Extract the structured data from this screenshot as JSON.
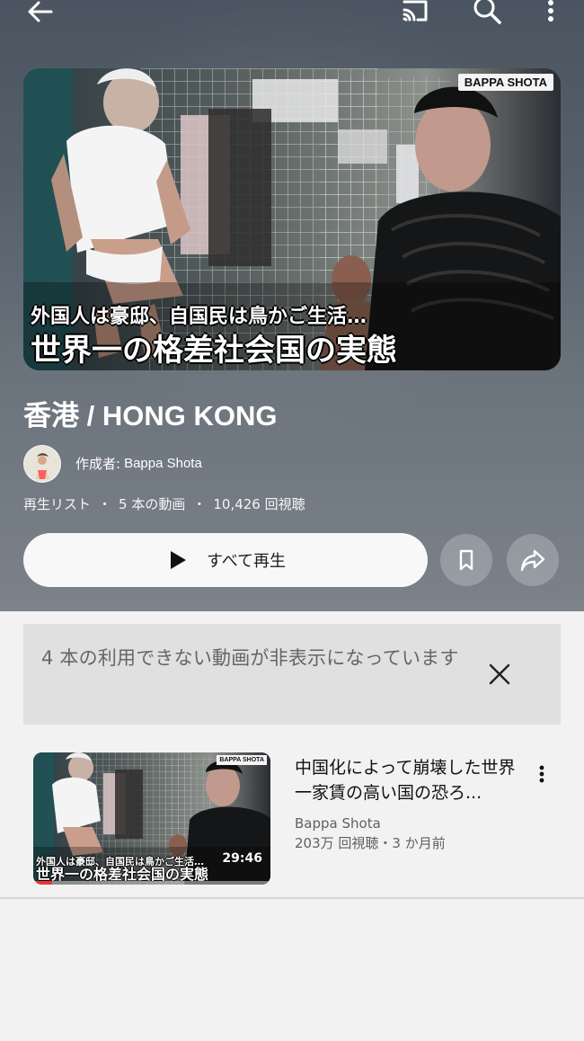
{
  "playlist": {
    "thumbnail": {
      "brand": "BAPPA SHOTA",
      "caption_line_1": "外国人は豪邸、自国民は鳥かご生活…",
      "caption_line_2": "世界一の格差社会国の実態"
    },
    "title": "香港 / HONG KONG",
    "creator_label": "作成者:",
    "creator_name": "Bappa Shota",
    "meta": {
      "type": "再生リスト",
      "video_count": "5 本の動画",
      "views": "10,426 回視聴"
    },
    "actions": {
      "play_all_label": "すべて再生"
    }
  },
  "notice": {
    "text": "4 本の利用できない動画が非表示になっています"
  },
  "videos": [
    {
      "title": "中国化によって崩壊した世界一家賃の高い国の恐ろ...",
      "channel": "Bappa Shota",
      "stats": "203万 回視聴・3 か月前",
      "duration": "29:46",
      "watch_progress": 0.08,
      "thumbnail": {
        "brand": "BAPPA SHOTA",
        "caption_line_1": "外国人は豪邸、自国民は鳥かご生活…",
        "caption_line_2": "世界一の格差社会国の実態"
      }
    }
  ],
  "icons": {
    "back": "arrow-left-icon",
    "cast": "cast-icon",
    "search": "search-icon",
    "more": "more-vertical-icon",
    "play": "play-icon",
    "save": "bookmark-icon",
    "share": "share-icon",
    "close": "close-icon"
  },
  "colors": {
    "header_background": "#56606b",
    "notice_background": "#e0e0e0",
    "page_background": "#f2f2f2",
    "progress": "#e33333"
  }
}
